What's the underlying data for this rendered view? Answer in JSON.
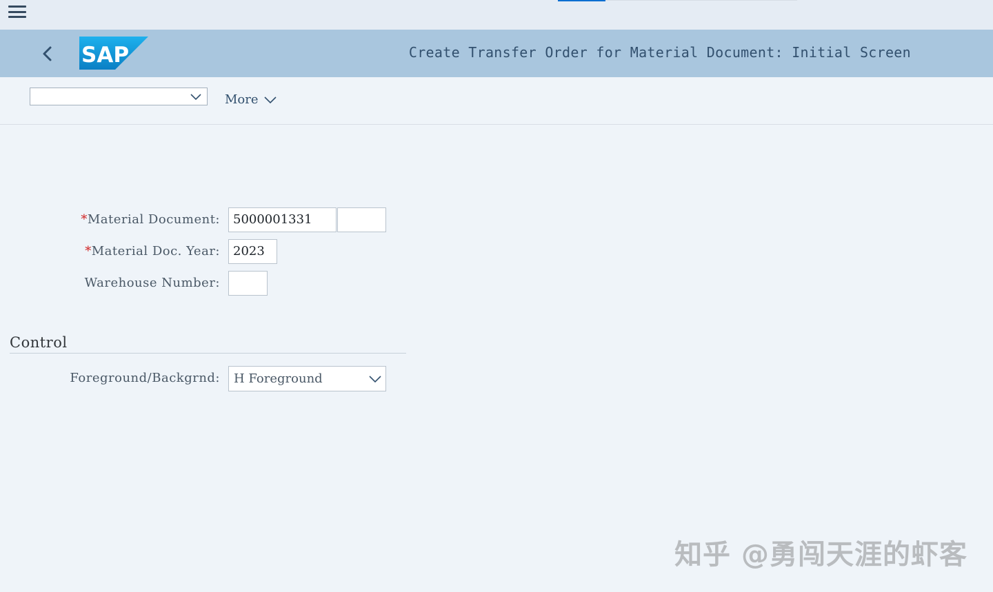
{
  "shell": {
    "title": "Create Transfer Order for Material Document: Initial Screen",
    "logo_text": "SAP"
  },
  "toolbar": {
    "variant_value": "",
    "more_label": "More"
  },
  "form": {
    "required_mark": "*",
    "material_document": {
      "label": "Material Document:",
      "value": "5000001331",
      "item_value": ""
    },
    "material_doc_year": {
      "label": "Material Doc. Year:",
      "value": "2023"
    },
    "warehouse_number": {
      "label": "Warehouse Number:",
      "value": ""
    }
  },
  "control": {
    "section_title": "Control",
    "foreground_background": {
      "label": "Foreground/Backgrnd:",
      "value": "H Foreground"
    }
  },
  "watermark": "知乎 @勇闯天涯的虾客",
  "colors": {
    "shellbar": "#a9c6de",
    "background": "#eff4f9",
    "accent": "#0a6ed1",
    "required": "#d01f1f"
  }
}
